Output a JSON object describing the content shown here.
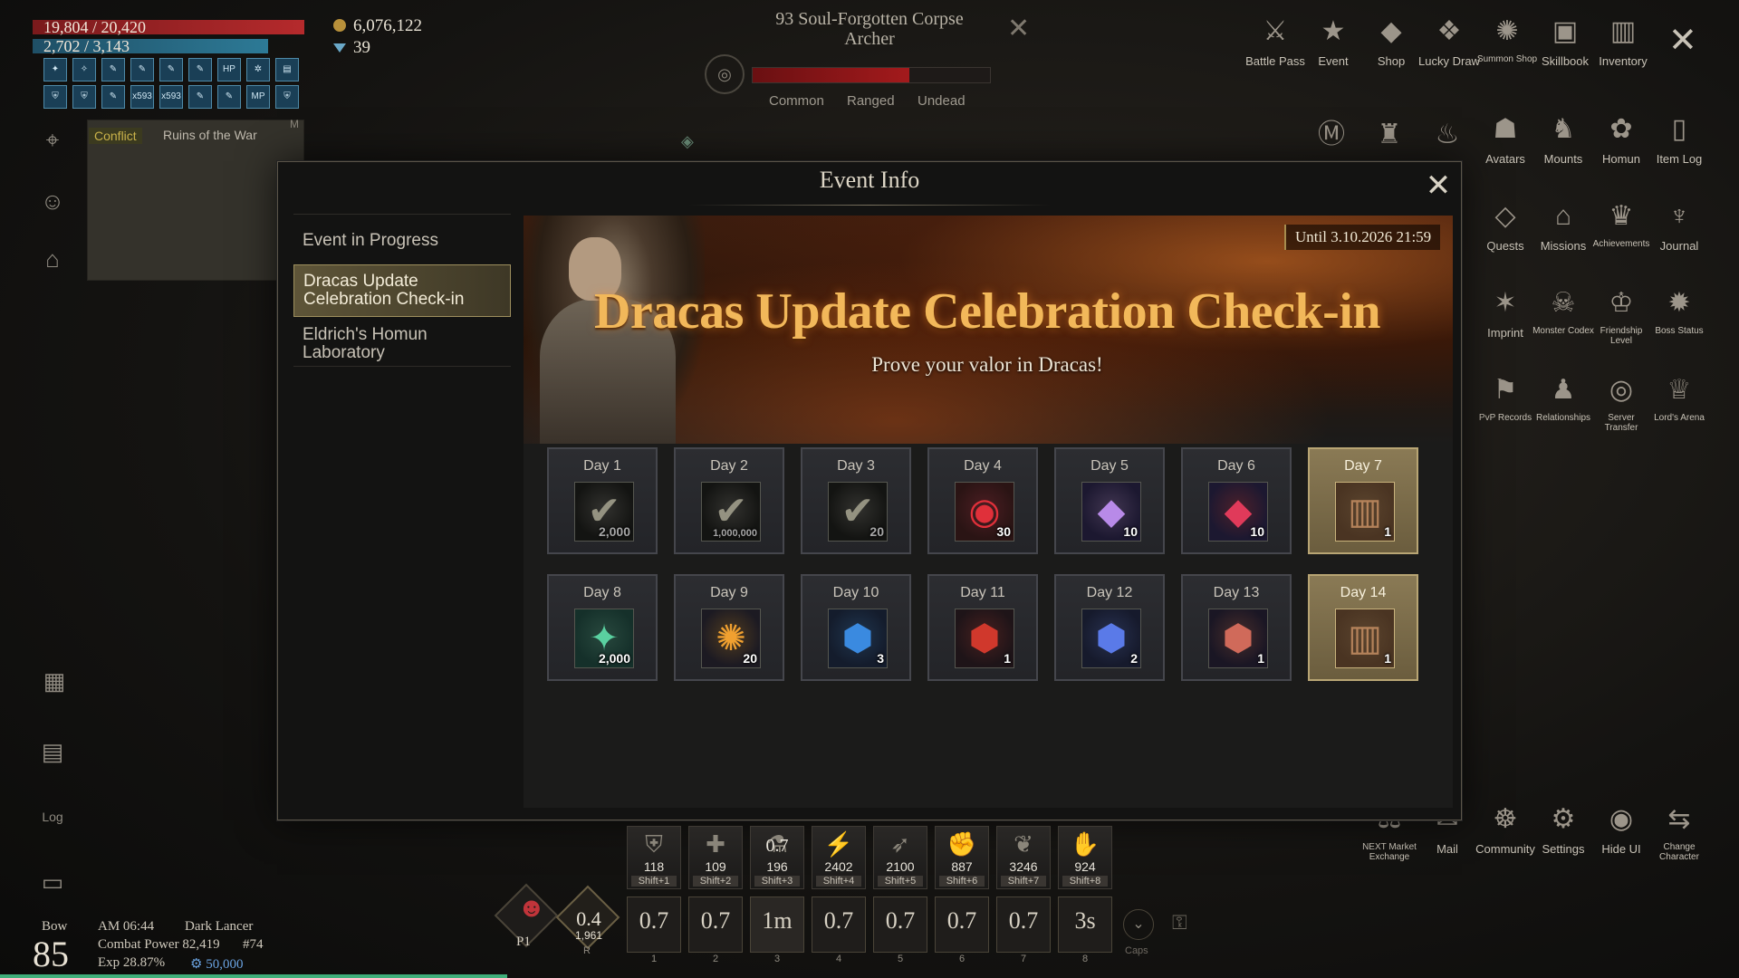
{
  "player": {
    "hp": "19,804 / 20,420",
    "mp": "2,702 / 3,143",
    "gold": "6,076,122",
    "gems": "39",
    "buffs": [
      "✦",
      "✧",
      "✎",
      "✎",
      "✎",
      "✎",
      "HP",
      "✲",
      "▤",
      "⛨",
      "⛨",
      "✎",
      "x593",
      "x593",
      "✎",
      "✎",
      "MP",
      "⛨"
    ]
  },
  "map": {
    "badge": "Conflict",
    "zone": "Ruins of the War",
    "corner": "M"
  },
  "target": {
    "name": "93 Soul-Forgotten Corpse Archer",
    "tags": [
      "Common",
      "Ranged",
      "Undead"
    ]
  },
  "menu": {
    "row1": [
      "Battle Pass",
      "Event",
      "Shop",
      "Lucky Draw",
      "Summon Shop",
      "Skillbook",
      "Inventory"
    ],
    "row2": [
      "Avatars",
      "Mounts",
      "Homun",
      "Item Log"
    ],
    "row3": [
      "Quests",
      "Missions",
      "Achievements",
      "Journal"
    ],
    "row4": [
      "Imprint",
      "Monster Codex",
      "Friendship Level",
      "Boss Status"
    ],
    "row5": [
      "PvP Records",
      "Relationships",
      "Server Transfer",
      "Lord's Arena"
    ],
    "bottom": [
      "NEXT Market Exchange",
      "Mail",
      "Community",
      "Settings",
      "Hide UI",
      "Change Character"
    ]
  },
  "modal": {
    "title": "Event Info",
    "sidebar": {
      "heading": "Event in Progress",
      "items": [
        "Dracas Update Celebration Check-in",
        "Eldrich's Homun Laboratory"
      ]
    },
    "banner": {
      "period": "Until 3.10.2026 21:59",
      "title": "Dracas Update Celebration Check-in",
      "subtitle": "Prove your valor in Dracas!"
    },
    "days": [
      {
        "label": "Day 1",
        "qty": "2,000",
        "glyph": "check",
        "claimed": true,
        "special": false
      },
      {
        "label": "Day 2",
        "qty": "1,000,000",
        "glyph": "check",
        "claimed": true,
        "special": false
      },
      {
        "label": "Day 3",
        "qty": "20",
        "glyph": "check",
        "claimed": true,
        "special": false
      },
      {
        "label": "Day 4",
        "qty": "30",
        "glyph": "red-orb",
        "claimed": false,
        "special": false
      },
      {
        "label": "Day 5",
        "qty": "10",
        "glyph": "purple-crystal",
        "claimed": false,
        "special": false
      },
      {
        "label": "Day 6",
        "qty": "10",
        "glyph": "red-crystal",
        "claimed": false,
        "special": false
      },
      {
        "label": "Day 7",
        "qty": "1",
        "glyph": "card-pack",
        "claimed": false,
        "special": true
      },
      {
        "label": "Day 8",
        "qty": "2,000",
        "glyph": "green-crystal",
        "claimed": false,
        "special": false
      },
      {
        "label": "Day 9",
        "qty": "20",
        "glyph": "fire-orb",
        "claimed": false,
        "special": false
      },
      {
        "label": "Day 10",
        "qty": "3",
        "glyph": "blue-gem",
        "claimed": false,
        "special": false
      },
      {
        "label": "Day 11",
        "qty": "1",
        "glyph": "red-gem",
        "claimed": false,
        "special": false
      },
      {
        "label": "Day 12",
        "qty": "2",
        "glyph": "blue-flame-gem",
        "claimed": false,
        "special": false
      },
      {
        "label": "Day 13",
        "qty": "1",
        "glyph": "rainbow-gem",
        "claimed": false,
        "special": false
      },
      {
        "label": "Day 14",
        "qty": "1",
        "glyph": "card-pack",
        "claimed": false,
        "special": true
      }
    ]
  },
  "hotbar": {
    "items": [
      {
        "count": "118",
        "key": "Shift+1"
      },
      {
        "count": "109",
        "key": "Shift+2"
      },
      {
        "count": "196",
        "key": "Shift+3",
        "cooldown": "0.7"
      },
      {
        "count": "2402",
        "key": "Shift+4"
      },
      {
        "count": "2100",
        "key": "Shift+5"
      },
      {
        "count": "887",
        "key": "Shift+6"
      },
      {
        "count": "3246",
        "key": "Shift+7"
      },
      {
        "count": "924",
        "key": "Shift+8"
      }
    ],
    "skills": [
      {
        "cd": "0.7",
        "key": "1"
      },
      {
        "cd": "0.7",
        "key": "2"
      },
      {
        "cd": "1m",
        "key": "3"
      },
      {
        "cd": "0.7",
        "key": "4"
      },
      {
        "cd": "0.7",
        "key": "5"
      },
      {
        "cd": "0.7",
        "key": "6"
      },
      {
        "cd": "0.7",
        "key": "7"
      },
      {
        "cd": "3s",
        "key": "8"
      }
    ],
    "pet_label": "P1",
    "potion": {
      "cd": "0.4",
      "count": "1,961",
      "key": "R"
    },
    "caps_label": "Caps"
  },
  "status": {
    "weapon": "Bow",
    "level": "85",
    "time": "AM 06:44",
    "class": "Dark Lancer",
    "combat_power": "Combat Power 82,419",
    "rank": "#74",
    "exp": "Exp 28.87%",
    "points": "50,000"
  },
  "colors": {
    "accent": "#f2b85a",
    "hp": "#b52a2c",
    "mp": "#2d7a96",
    "selected": "#5e5538"
  }
}
